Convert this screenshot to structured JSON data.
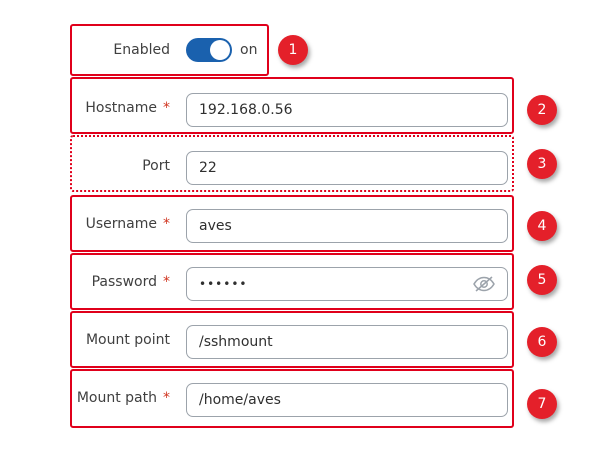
{
  "enabled": {
    "label": "Enabled",
    "state_text": "on",
    "on": true
  },
  "hostname": {
    "label": "Hostname",
    "required_mark": "*",
    "value": "192.168.0.56"
  },
  "port": {
    "label": "Port",
    "value": "22"
  },
  "username": {
    "label": "Username",
    "required_mark": "*",
    "value": "aves"
  },
  "password": {
    "label": "Password",
    "required_mark": "*",
    "value": "••••••",
    "toggle_icon": "eye-slash-icon"
  },
  "mount_point": {
    "label": "Mount point",
    "value": "/sshmount"
  },
  "mount_path": {
    "label": "Mount path",
    "required_mark": "*",
    "value": "/home/aves"
  },
  "badges": [
    "1",
    "2",
    "3",
    "4",
    "5",
    "6",
    "7"
  ],
  "colors": {
    "highlight": "#e0001b",
    "toggle_on": "#1a61ae",
    "badge": "#e4202a",
    "required": "#d0341f"
  }
}
